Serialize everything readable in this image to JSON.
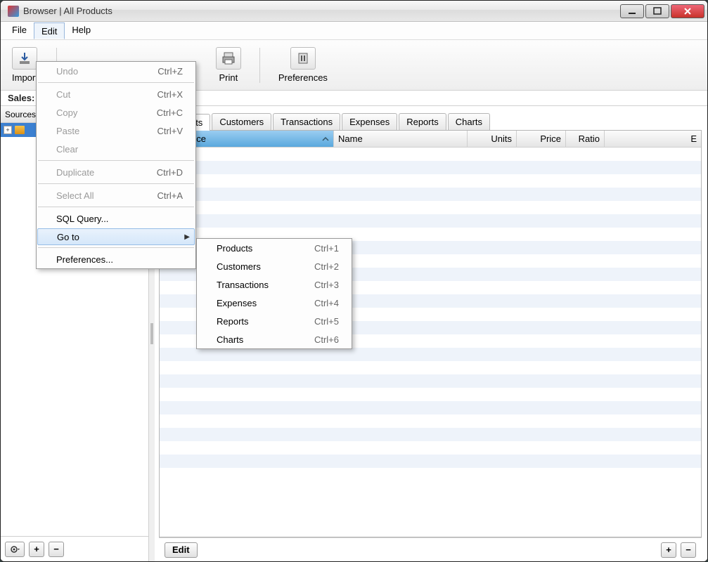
{
  "window": {
    "title": "Browser | All Products"
  },
  "menubar": {
    "file": "File",
    "edit": "Edit",
    "help": "Help"
  },
  "toolbar": {
    "import_label": "Import",
    "print_label": "Print",
    "preferences_label": "Preferences"
  },
  "statusline": "Sales: 0,00 | Returned: 0,00 (0,00%)",
  "sidebar": {
    "header": "Sources",
    "root_label": ""
  },
  "tabs": {
    "products": "Products",
    "customers": "Customers",
    "transactions": "Transactions",
    "expenses": "Expenses",
    "reports": "Reports",
    "charts": "Charts"
  },
  "columns": {
    "reference": "Reference",
    "name": "Name",
    "units": "Units",
    "price": "Price",
    "ratio": "Ratio",
    "extra": "E"
  },
  "bottombar": {
    "edit": "Edit",
    "plus": "+",
    "minus": "−"
  },
  "sidebar_bottom": {
    "plus": "+",
    "minus": "−"
  },
  "edit_menu": {
    "undo": "Undo",
    "undo_sc": "Ctrl+Z",
    "cut": "Cut",
    "cut_sc": "Ctrl+X",
    "copy": "Copy",
    "copy_sc": "Ctrl+C",
    "paste": "Paste",
    "paste_sc": "Ctrl+V",
    "clear": "Clear",
    "duplicate": "Duplicate",
    "duplicate_sc": "Ctrl+D",
    "selectall": "Select All",
    "selectall_sc": "Ctrl+A",
    "sql": "SQL Query...",
    "goto": "Go to",
    "prefs": "Preferences..."
  },
  "goto_menu": {
    "products": "Products",
    "products_sc": "Ctrl+1",
    "customers": "Customers",
    "customers_sc": "Ctrl+2",
    "transactions": "Transactions",
    "transactions_sc": "Ctrl+3",
    "expenses": "Expenses",
    "expenses_sc": "Ctrl+4",
    "reports": "Reports",
    "reports_sc": "Ctrl+5",
    "charts": "Charts",
    "charts_sc": "Ctrl+6"
  }
}
